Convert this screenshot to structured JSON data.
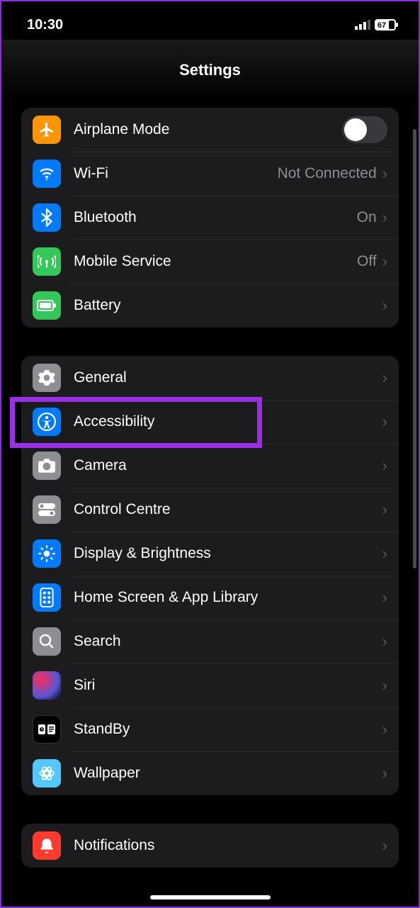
{
  "status": {
    "time": "10:30",
    "battery": "67"
  },
  "header": {
    "title": "Settings"
  },
  "group1": [
    {
      "key": "airplane",
      "label": "Airplane Mode",
      "toggle": false
    },
    {
      "key": "wifi",
      "label": "Wi-Fi",
      "value": "Not Connected"
    },
    {
      "key": "bluetooth",
      "label": "Bluetooth",
      "value": "On"
    },
    {
      "key": "mobile",
      "label": "Mobile Service",
      "value": "Off"
    },
    {
      "key": "battery",
      "label": "Battery"
    }
  ],
  "group2": [
    {
      "key": "general",
      "label": "General"
    },
    {
      "key": "accessibility",
      "label": "Accessibility",
      "highlighted": true
    },
    {
      "key": "camera",
      "label": "Camera"
    },
    {
      "key": "control-centre",
      "label": "Control Centre"
    },
    {
      "key": "display",
      "label": "Display & Brightness"
    },
    {
      "key": "home-screen",
      "label": "Home Screen & App Library"
    },
    {
      "key": "search",
      "label": "Search"
    },
    {
      "key": "siri",
      "label": "Siri"
    },
    {
      "key": "standby",
      "label": "StandBy"
    },
    {
      "key": "wallpaper",
      "label": "Wallpaper"
    }
  ],
  "group3": [
    {
      "key": "notifications",
      "label": "Notifications"
    }
  ]
}
